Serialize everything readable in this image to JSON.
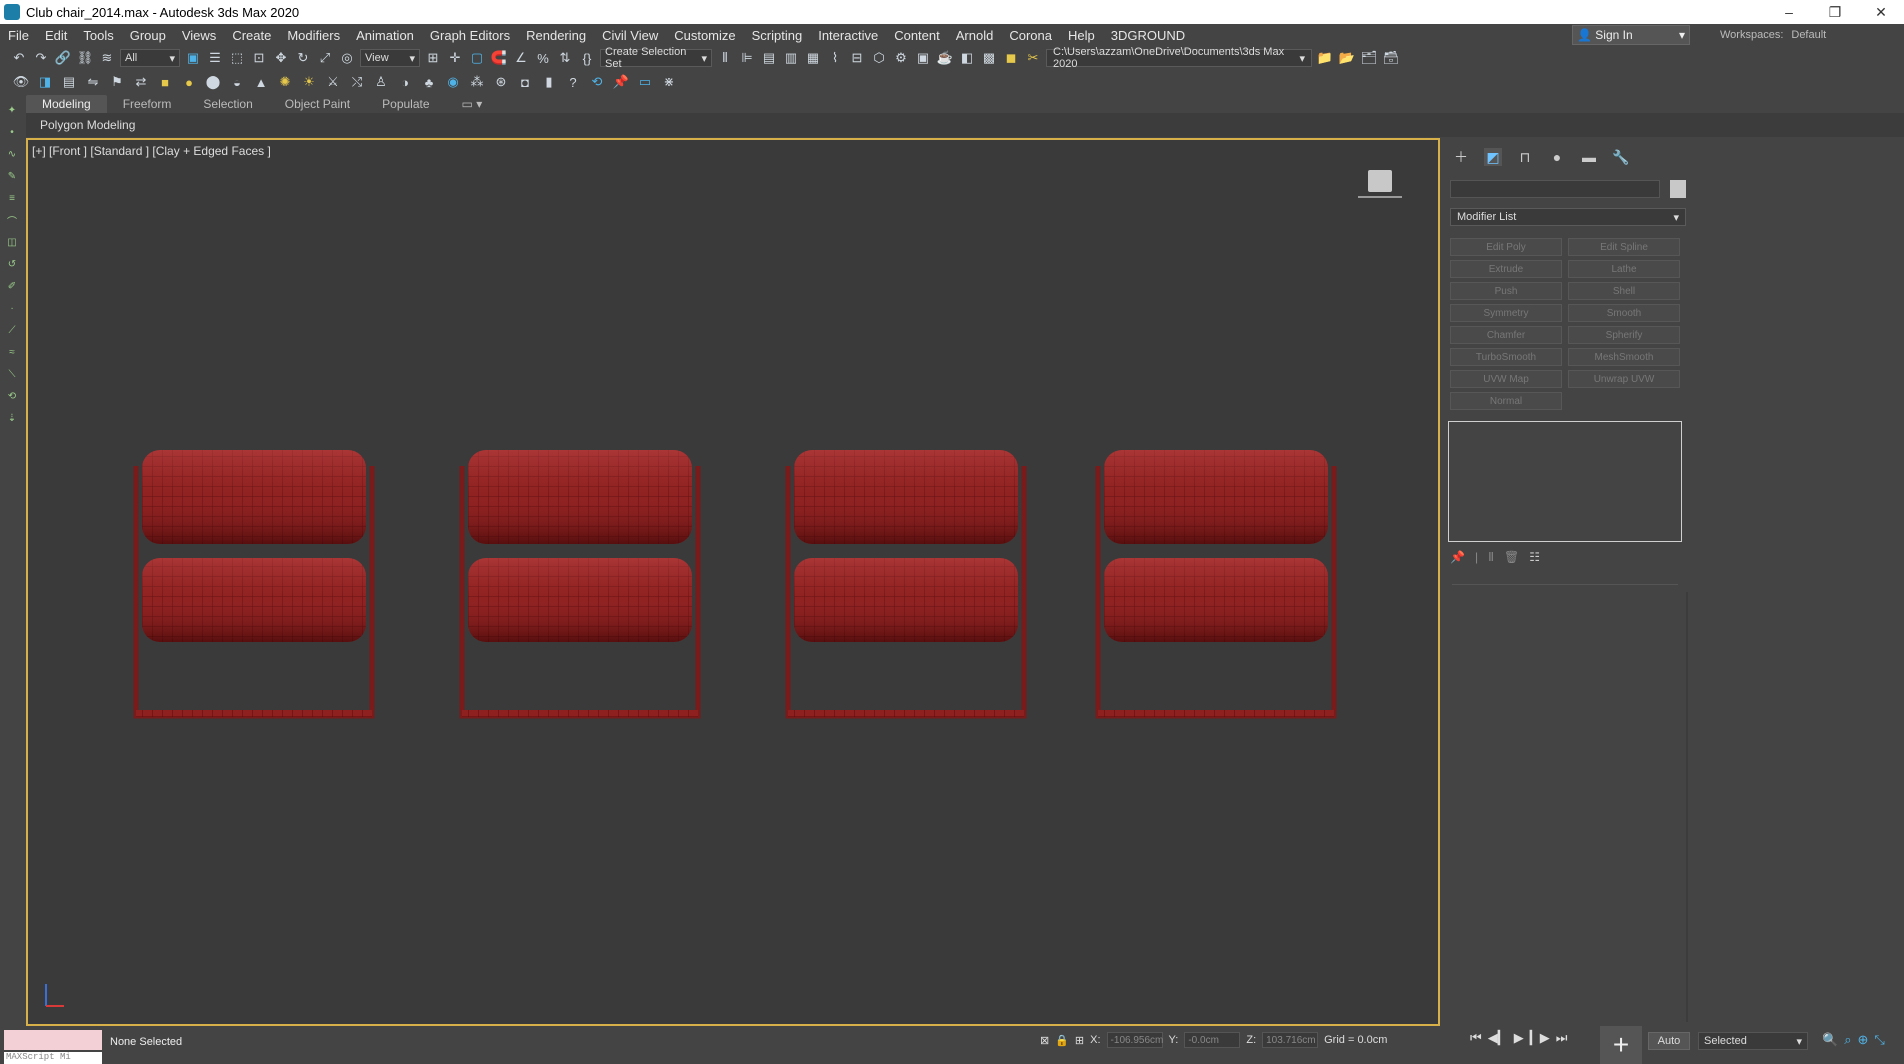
{
  "window": {
    "title": "Club chair_2014.max - Autodesk 3ds Max 2020",
    "minimize": "–",
    "maximize": "❐",
    "close": "✕"
  },
  "menu": [
    "File",
    "Edit",
    "Tools",
    "Group",
    "Views",
    "Create",
    "Modifiers",
    "Animation",
    "Graph Editors",
    "Rendering",
    "Civil View",
    "Customize",
    "Scripting",
    "Interactive",
    "Content",
    "Arnold",
    "Corona",
    "Help",
    "3DGROUND"
  ],
  "account": {
    "sign_in": "Sign In",
    "workspaces_label": "Workspaces:",
    "workspace": "Default"
  },
  "toolbar": {
    "filter": "All",
    "ref_coord": "View",
    "selection_set": "Create Selection Set",
    "project_path": "C:\\Users\\azzam\\OneDrive\\Documents\\3ds Max 2020"
  },
  "ribbon": {
    "tabs": [
      "Modeling",
      "Freeform",
      "Selection",
      "Object Paint",
      "Populate"
    ],
    "active": "Modeling",
    "panel": "Polygon Modeling"
  },
  "viewport": {
    "label": "[+] [Front ] [Standard ] [Clay + Edged Faces ]"
  },
  "command_panel": {
    "modifier_list": "Modifier List",
    "modifiers": [
      "Edit Poly",
      "Edit Spline",
      "Extrude",
      "Lathe",
      "Push",
      "Shell",
      "Symmetry",
      "Smooth",
      "Chamfer",
      "Spherify",
      "TurboSmooth",
      "MeshSmooth",
      "UVW Map",
      "Unwrap UVW",
      "Normal"
    ]
  },
  "status": {
    "selection": "None Selected",
    "maxscript": "MAXScript Mi",
    "x_label": "X:",
    "x": "-106.956cm",
    "y_label": "Y:",
    "y": "-0.0cm",
    "z_label": "Z:",
    "z": "103.716cm",
    "grid": "Grid = 0.0cm",
    "auto_key": "Auto",
    "key_filter": "Selected"
  },
  "colors": {
    "accent": "#d8b04a",
    "chair": "#8e2020",
    "chair_light": "#c84a4a",
    "bg": "#444444"
  },
  "icons": [
    "undo-icon",
    "redo-icon",
    "link-icon",
    "unlink-icon",
    "select-icon",
    "move-icon",
    "rotate-icon",
    "scale-icon",
    "snap-icon",
    "mirror-icon",
    "align-icon",
    "render-icon",
    "play-icon",
    "plus-icon",
    "zoom-icon"
  ]
}
